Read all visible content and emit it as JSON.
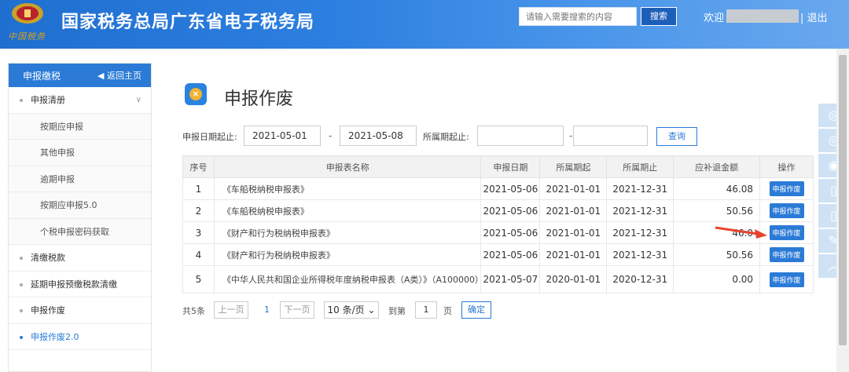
{
  "header": {
    "site_title": "国家税务总局广东省电子税务局",
    "logo_sub": "中国税务",
    "search_placeholder": "请输入需要搜索的内容",
    "search_button": "搜索",
    "welcome": "欢迎",
    "logout": "| 退出"
  },
  "sidebar": {
    "title": "申报缴税",
    "back": "◀ 返回主页",
    "items": [
      {
        "label": "申报清册",
        "level": 1,
        "expanded": true
      },
      {
        "label": "按期应申报",
        "level": 2
      },
      {
        "label": "其他申报",
        "level": 2
      },
      {
        "label": "逾期申报",
        "level": 2
      },
      {
        "label": "按期应申报5.0",
        "level": 2
      },
      {
        "label": "个税申报密码获取",
        "level": 2
      },
      {
        "label": "清缴税款",
        "level": 1
      },
      {
        "label": "延期申报预缴税款清缴",
        "level": 1
      },
      {
        "label": "申报作废",
        "level": 1
      },
      {
        "label": "申报作废2.0",
        "level": 1,
        "active": true
      }
    ]
  },
  "main": {
    "page_title": "申报作废",
    "filters": {
      "declare_date_label": "申报日期起止:",
      "declare_start": "2021-05-01",
      "declare_end": "2021-05-08",
      "period_label": "所属期起止:",
      "period_start": "",
      "period_end": "",
      "dash": "-",
      "query_button": "查询"
    },
    "table": {
      "headers": [
        "序号",
        "申报表名称",
        "申报日期",
        "所属期起",
        "所属期止",
        "应补退金额",
        "操作"
      ],
      "rows": [
        {
          "no": "1",
          "name": "《车船税纳税申报表》",
          "declare_date": "2021-05-06",
          "period_start": "2021-01-01",
          "period_end": "2021-12-31",
          "amount": "46.08",
          "action": "申报作废"
        },
        {
          "no": "2",
          "name": "《车船税纳税申报表》",
          "declare_date": "2021-05-06",
          "period_start": "2021-01-01",
          "period_end": "2021-12-31",
          "amount": "50.56",
          "action": "申报作废"
        },
        {
          "no": "3",
          "name": "《财产和行为税纳税申报表》",
          "declare_date": "2021-05-06",
          "period_start": "2021-01-01",
          "period_end": "2021-12-31",
          "amount": "46.0",
          "action": "申报作废"
        },
        {
          "no": "4",
          "name": "《财产和行为税纳税申报表》",
          "declare_date": "2021-05-06",
          "period_start": "2021-01-01",
          "period_end": "2021-12-31",
          "amount": "50.56",
          "action": "申报作废"
        },
        {
          "no": "5",
          "name": "《中华人民共和国企业所得税年度纳税申报表（A类）》（A100000）",
          "declare_date": "2021-05-07",
          "period_start": "2020-01-01",
          "period_end": "2020-12-31",
          "amount": "0.00",
          "action": "申报作废"
        }
      ]
    },
    "pager": {
      "total": "共5条",
      "prev": "上一页",
      "current": "1",
      "next": "下一页",
      "page_size": "10 条/页",
      "goto": "到第",
      "goto_value": "1",
      "page_unit": "页",
      "confirm": "确定"
    }
  },
  "floatbar": {
    "icons": [
      "wechat-icon",
      "wechat-icon",
      "weibo-icon",
      "mobile-icon",
      "mobile-icon",
      "edit-icon",
      "back-to-top-icon"
    ]
  },
  "colors": {
    "accent": "#2a7ad6",
    "header_start": "#1f6fd0",
    "header_end": "#6aa8ee",
    "arrow": "#e8432e"
  }
}
